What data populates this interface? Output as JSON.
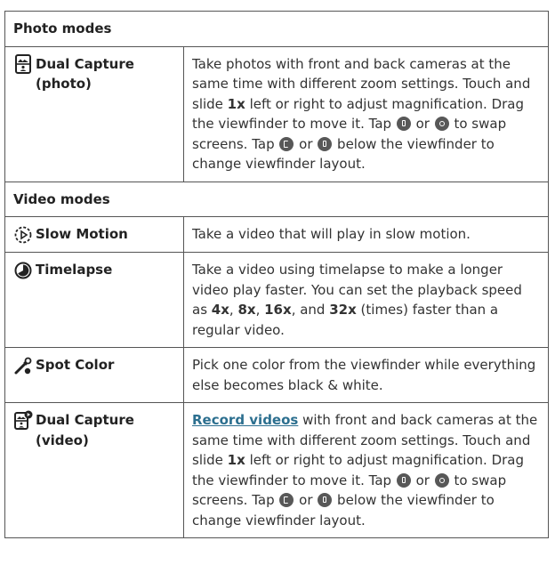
{
  "photo_section": {
    "label": "Photo modes"
  },
  "video_section": {
    "label": "Video modes"
  },
  "rows": {
    "dual_photo": {
      "title_line1": "Dual Capture",
      "title_line2": "(photo)",
      "d1": "Take photos with front and back cameras at the same time with different zoom settings. Touch and slide ",
      "d2": "1x",
      "d3": " left or right to adjust magnification. Drag the viewfinder to move it. Tap ",
      "d4": " or ",
      "d5": " to swap screens. Tap ",
      "d6": " or ",
      "d7": " below the viewfinder to change viewfinder layout."
    },
    "slow_motion": {
      "title": "Slow Motion",
      "desc": "Take a video that will play in slow motion."
    },
    "timelapse": {
      "title": "Timelapse",
      "d1": "Take a video using timelapse to make a longer video play faster. You can set the playback speed as ",
      "d2": "4x",
      "d3": ", ",
      "d4": "8x",
      "d5": ", ",
      "d6": "16x",
      "d7": ", and ",
      "d8": "32x",
      "d9": " (times) faster than a regular video."
    },
    "spot_color": {
      "title": "Spot Color",
      "desc": "Pick one color from the viewfinder while everything else becomes black & white."
    },
    "dual_video": {
      "title_line1": "Dual Capture",
      "title_line2": "(video)",
      "link": "Record videos",
      "d1": " with front and back cameras at the same time with different zoom settings. Touch and slide ",
      "d2": "1x",
      "d3": " left or right to adjust magnification. Drag the viewfinder to move it. Tap ",
      "d4": " or ",
      "d5": " to swap screens. Tap ",
      "d6": " or ",
      "d7": " below the viewfinder to change viewfinder layout."
    }
  },
  "icons": {
    "dual_photo": "dual-capture-photo-icon",
    "slow_motion": "slow-motion-icon",
    "timelapse": "timelapse-icon",
    "spot_color": "spot-color-icon",
    "dual_video": "dual-capture-video-icon",
    "swap_a": "swap-screen-icon",
    "swap_b": "swap-screen-alt-icon",
    "layout_a": "viewfinder-layout-icon",
    "layout_b": "viewfinder-layout-alt-icon"
  },
  "colors": {
    "link": "#2c6f8f",
    "border": "#555555",
    "text": "#222222",
    "button_dot": "#585858"
  }
}
